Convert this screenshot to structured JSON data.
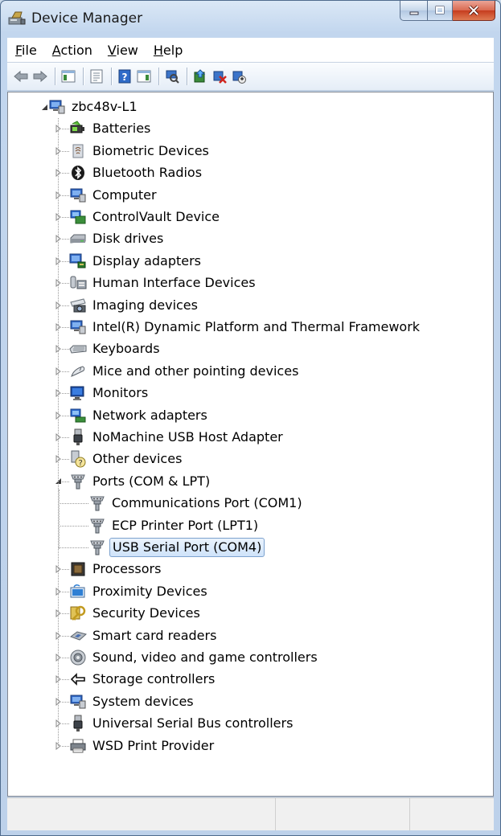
{
  "window": {
    "title": "Device Manager"
  },
  "menu": [
    {
      "mnemonic": "F",
      "rest": "ile"
    },
    {
      "mnemonic": "A",
      "rest": "ction"
    },
    {
      "mnemonic": "V",
      "rest": "iew"
    },
    {
      "mnemonic": "H",
      "rest": "elp"
    }
  ],
  "toolbar": [
    "back-arrow-icon",
    "forward-arrow-icon",
    "|",
    "show-hide-console-tree-icon",
    "|",
    "properties-icon",
    "|",
    "help-icon",
    "action-pane-icon",
    "|",
    "scan-hardware-icon",
    "|",
    "update-driver-icon",
    "uninstall-device-icon",
    "disable-device-icon"
  ],
  "tree": {
    "root": {
      "label": "zbc48v-L1",
      "icon": "computer-icon",
      "expanded": true
    },
    "categories": [
      {
        "label": "Batteries",
        "icon": "battery-icon"
      },
      {
        "label": "Biometric Devices",
        "icon": "biometric-icon"
      },
      {
        "label": "Bluetooth Radios",
        "icon": "bluetooth-icon"
      },
      {
        "label": "Computer",
        "icon": "computer-icon"
      },
      {
        "label": "ControlVault Device",
        "icon": "controlvault-icon"
      },
      {
        "label": "Disk drives",
        "icon": "disk-drive-icon"
      },
      {
        "label": "Display adapters",
        "icon": "display-adapter-icon"
      },
      {
        "label": "Human Interface Devices",
        "icon": "hid-icon"
      },
      {
        "label": "Imaging devices",
        "icon": "camera-icon"
      },
      {
        "label": "Intel(R) Dynamic Platform and Thermal Framework",
        "icon": "computer-icon"
      },
      {
        "label": "Keyboards",
        "icon": "keyboard-icon"
      },
      {
        "label": "Mice and other pointing devices",
        "icon": "mouse-icon"
      },
      {
        "label": "Monitors",
        "icon": "monitor-icon"
      },
      {
        "label": "Network adapters",
        "icon": "network-adapter-icon"
      },
      {
        "label": "NoMachine USB Host Adapter",
        "icon": "usb-plug-icon"
      },
      {
        "label": "Other devices",
        "icon": "unknown-device-icon"
      },
      {
        "label": "Ports (COM & LPT)",
        "icon": "port-icon",
        "expanded": true,
        "children": [
          {
            "label": "Communications Port (COM1)",
            "icon": "port-icon"
          },
          {
            "label": "ECP Printer Port (LPT1)",
            "icon": "port-icon"
          },
          {
            "label": "USB Serial Port (COM4)",
            "icon": "port-icon",
            "selected": true
          }
        ]
      },
      {
        "label": "Processors",
        "icon": "processor-icon"
      },
      {
        "label": "Proximity Devices",
        "icon": "proximity-icon"
      },
      {
        "label": "Security Devices",
        "icon": "security-key-icon"
      },
      {
        "label": "Smart card readers",
        "icon": "smart-card-icon"
      },
      {
        "label": "Sound, video and game controllers",
        "icon": "speaker-icon"
      },
      {
        "label": "Storage controllers",
        "icon": "storage-controller-icon"
      },
      {
        "label": "System devices",
        "icon": "computer-icon"
      },
      {
        "label": "Universal Serial Bus controllers",
        "icon": "usb-plug-icon"
      },
      {
        "label": "WSD Print Provider",
        "icon": "printer-icon"
      }
    ]
  },
  "colors": {
    "selection_border": "#7da2ce",
    "selection_fill": "#cfe3fa",
    "frame": "#bdd1ea"
  }
}
